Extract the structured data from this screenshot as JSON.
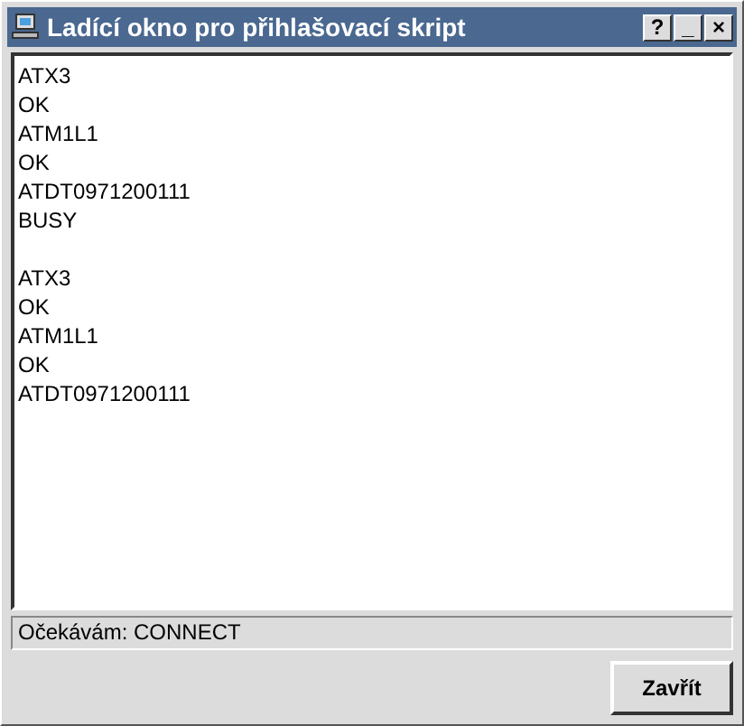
{
  "window": {
    "title": "Ladící okno pro přihlašovací skript",
    "buttons": [
      "?",
      "_",
      "×"
    ]
  },
  "log": [
    [
      "ATX3",
      "OK",
      "ATM1L1",
      "OK",
      "ATDT0971200111",
      "BUSY"
    ],
    [
      "ATX3",
      "OK",
      "ATM1L1",
      "OK",
      "ATDT0971200111"
    ]
  ],
  "status": "Očekávám: CONNECT",
  "close_button": "Zavřít"
}
